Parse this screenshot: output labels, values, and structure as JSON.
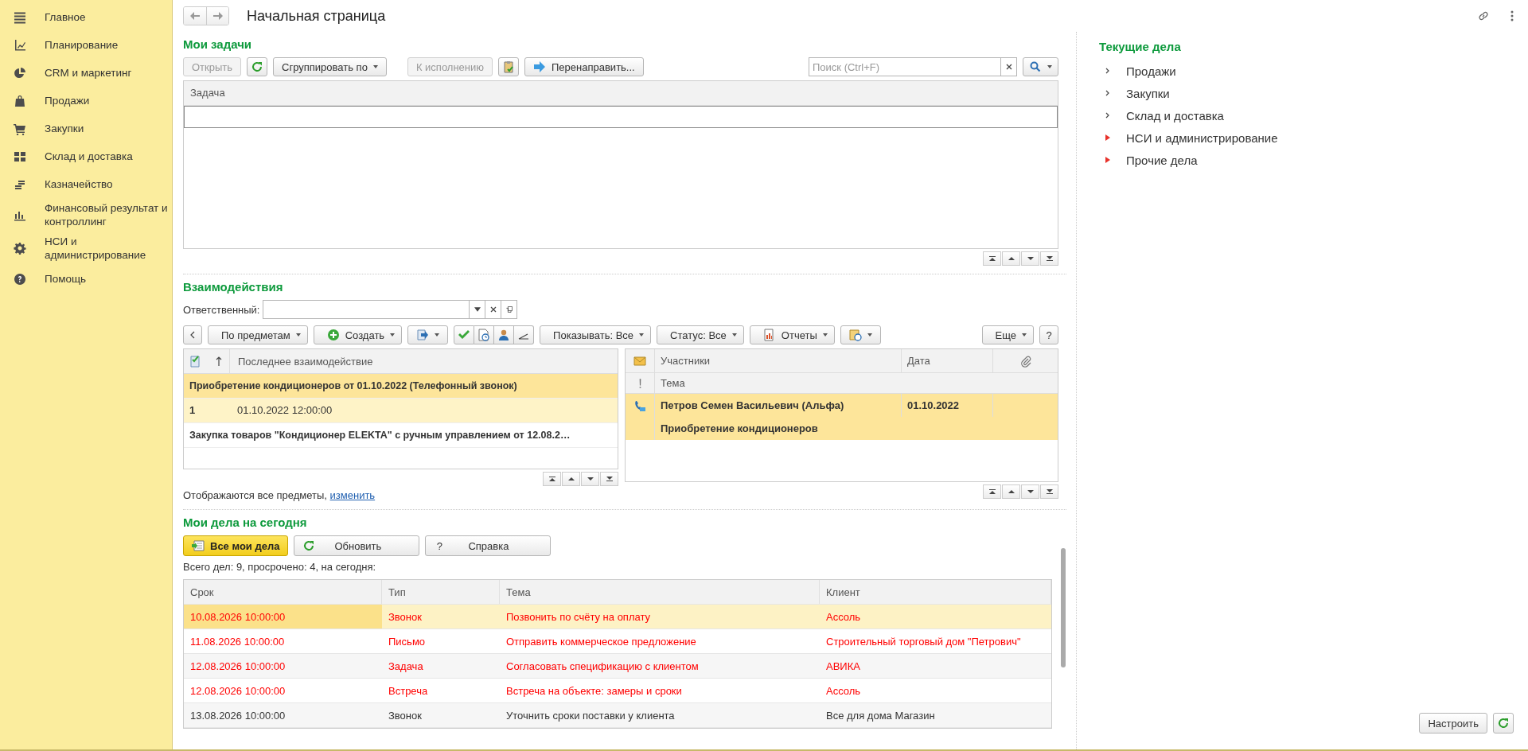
{
  "window": {
    "title": "Начальная страница"
  },
  "sidebar": {
    "items": [
      {
        "label": "Главное"
      },
      {
        "label": "Планирование"
      },
      {
        "label": "CRM и маркетинг"
      },
      {
        "label": "Продажи"
      },
      {
        "label": "Закупки"
      },
      {
        "label": "Склад и доставка"
      },
      {
        "label": "Казначейство"
      },
      {
        "label": "Финансовый результат и контроллинг"
      },
      {
        "label": "НСИ и администрирование"
      },
      {
        "label": "Помощь"
      }
    ]
  },
  "my_tasks": {
    "title": "Мои задачи",
    "toolbar": {
      "open": {
        "label": "Открыть",
        "disabled": true
      },
      "group_by": {
        "label": "Сгруппировать по",
        "disabled": false
      },
      "execute": {
        "label": "К исполнению",
        "disabled": true
      },
      "forward": {
        "label": "Перенаправить...",
        "disabled": false
      }
    },
    "search": {
      "placeholder": "Поиск (Ctrl+F)"
    },
    "table": {
      "columns": [
        "Задача"
      ]
    }
  },
  "interactions": {
    "title": "Взаимодействия",
    "responsible_label": "Ответственный:",
    "toolbar": {
      "by_subject": "По предметам",
      "create": "Создать",
      "show": "Показывать: Все",
      "status": "Статус: Все",
      "reports": "Отчеты",
      "more": "Еще",
      "help": "?"
    },
    "subjects": {
      "column": "Последнее взаимодействие",
      "rows": [
        {
          "kind": "group",
          "text": "Приобретение кондиционеров от 01.10.2022 (Телефонный звонок)",
          "selected": true
        },
        {
          "kind": "item",
          "count": "1",
          "date": "01.10.2022 12:00:00",
          "selected": true
        },
        {
          "kind": "group",
          "text": "Закупка товаров \"Кондиционер ELEKTA\" с ручным управлением от 12.08.2…",
          "selected": false
        }
      ]
    },
    "footer": {
      "text": "Отображаются все предметы,",
      "link": "изменить"
    },
    "list": {
      "columns": [
        "Участники",
        "Дата"
      ],
      "subcolumn": "Тема",
      "rows": [
        {
          "participants": "Петров Семен Васильевич (Альфа)",
          "date": "01.10.2022",
          "topic": "Приобретение кондиционеров",
          "selected": true
        }
      ]
    }
  },
  "today": {
    "title": "Мои дела на сегодня",
    "buttons": {
      "all": "Все мои дела",
      "refresh": "Обновить",
      "help_mark": "?",
      "help": "Справка"
    },
    "summary": "Всего дел: 9, просрочено: 4, на сегодня:",
    "columns": [
      "Срок",
      "Тип",
      "Тема",
      "Клиент"
    ],
    "rows": [
      {
        "cells": [
          "10.08.2026 10:00:00",
          "Звонок",
          "Позвонить по счёту на оплату",
          "Ассоль"
        ],
        "overdue": true,
        "selected": true
      },
      {
        "cells": [
          "11.08.2026 10:00:00",
          "Письмо",
          "Отправить коммерческое предложение",
          "Строительный торговый дом \"Петрович\""
        ],
        "overdue": true,
        "selected": false
      },
      {
        "cells": [
          "12.08.2026 10:00:00",
          "Задача",
          "Согласовать спецификацию с клиентом",
          "АВИКА"
        ],
        "overdue": true,
        "selected": false
      },
      {
        "cells": [
          "12.08.2026 10:00:00",
          "Встреча",
          "Встреча на объекте: замеры и сроки",
          "Ассоль"
        ],
        "overdue": true,
        "selected": false
      },
      {
        "cells": [
          "13.08.2026 10:00:00",
          "Звонок",
          "Уточнить сроки поставки у клиента",
          "Все для дома Магазин"
        ],
        "overdue": false,
        "selected": false
      }
    ]
  },
  "current": {
    "title": "Текущие дела",
    "items": [
      {
        "label": "Продажи",
        "kind": "normal"
      },
      {
        "label": "Закупки",
        "kind": "normal"
      },
      {
        "label": "Склад и доставка",
        "kind": "normal"
      },
      {
        "label": "НСИ и администрирование",
        "kind": "attention"
      },
      {
        "label": "Прочие дела",
        "kind": "attention"
      }
    ]
  },
  "panel_buttons": {
    "configure": "Настроить"
  }
}
